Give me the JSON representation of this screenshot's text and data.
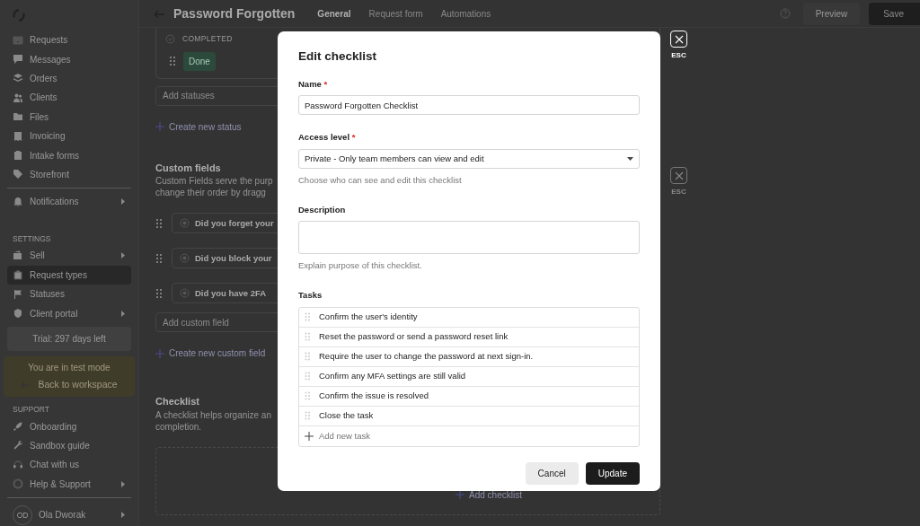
{
  "header": {
    "title": "Password Forgotten",
    "tabs": [
      {
        "label": "General",
        "selected": true
      },
      {
        "label": "Request form",
        "selected": false
      },
      {
        "label": "Automations",
        "selected": false
      }
    ],
    "preview_button": "Preview",
    "save_button": "Save"
  },
  "sidebar": {
    "nav": [
      {
        "label": "Requests",
        "selected": false,
        "submenu": false
      },
      {
        "label": "Messages",
        "selected": false,
        "submenu": false
      },
      {
        "label": "Orders",
        "selected": false,
        "submenu": false
      },
      {
        "label": "Clients",
        "selected": false,
        "submenu": false
      },
      {
        "label": "Files",
        "selected": false,
        "submenu": false
      },
      {
        "label": "Invoicing",
        "selected": false,
        "submenu": false
      },
      {
        "label": "Intake forms",
        "selected": false,
        "submenu": false
      },
      {
        "label": "Storefront",
        "selected": false,
        "submenu": false
      }
    ],
    "notifications": {
      "label": "Notifications",
      "selected": false,
      "submenu": true
    },
    "settings_heading": "SETTINGS",
    "settings": [
      {
        "label": "Sell",
        "selected": false,
        "submenu": true
      },
      {
        "label": "Request types",
        "selected": true,
        "submenu": false
      },
      {
        "label": "Statuses",
        "selected": false,
        "submenu": false
      },
      {
        "label": "Client portal",
        "selected": false,
        "submenu": true
      }
    ],
    "trial": "Trial: 297 days left",
    "test_mode": {
      "text": "You are in test mode",
      "link": "Back to workspace"
    },
    "support_heading": "SUPPORT",
    "support": [
      {
        "label": "Onboarding",
        "selected": false,
        "submenu": false
      },
      {
        "label": "Sandbox guide",
        "selected": false,
        "submenu": false
      },
      {
        "label": "Chat with us",
        "selected": false,
        "submenu": false
      },
      {
        "label": "Help & Support",
        "selected": false,
        "submenu": true
      }
    ],
    "user": {
      "initials": "OD",
      "name": "Ola Dworak"
    }
  },
  "statuses": {
    "group": "COMPLETED",
    "badge": "Done",
    "add_placeholder": "Add statuses",
    "create_link": "Create new status"
  },
  "custom_fields": {
    "title": "Custom fields",
    "description": [
      "Custom Fields serve the purp",
      "change their order by dragg"
    ],
    "fields": [
      "Did you forget your",
      "Did you block your",
      "Did you have 2FA"
    ],
    "add_placeholder": "Add custom field",
    "create_link": "Create new custom field"
  },
  "checklist": {
    "title": "Checklist",
    "description": [
      "A checklist helps organize an",
      "completion."
    ],
    "add_link": "Add checklist"
  },
  "back_close": {
    "label": "ESC"
  },
  "modal": {
    "title": "Edit checklist",
    "close": {
      "label": "ESC"
    },
    "name": {
      "label": "Name",
      "required_mark": "*",
      "value": "Password Forgotten Checklist"
    },
    "access": {
      "label": "Access level",
      "required_mark": "*",
      "value": "Private - Only team members can view and edit",
      "help": "Choose who can see and edit this checklist"
    },
    "description": {
      "label": "Description",
      "help": "Explain purpose of this checklist."
    },
    "tasks_label": "Tasks",
    "tasks": [
      "Confirm the user's identity",
      "Reset the password or send a password reset link",
      "Require the user to change the password at next sign-in.",
      "Confirm any MFA settings are still valid",
      "Confirm the issue is resolved",
      "Close the task"
    ],
    "add_task": {
      "placeholder": "Add new task"
    },
    "cancel_button": "Cancel",
    "update_button": "Update"
  }
}
